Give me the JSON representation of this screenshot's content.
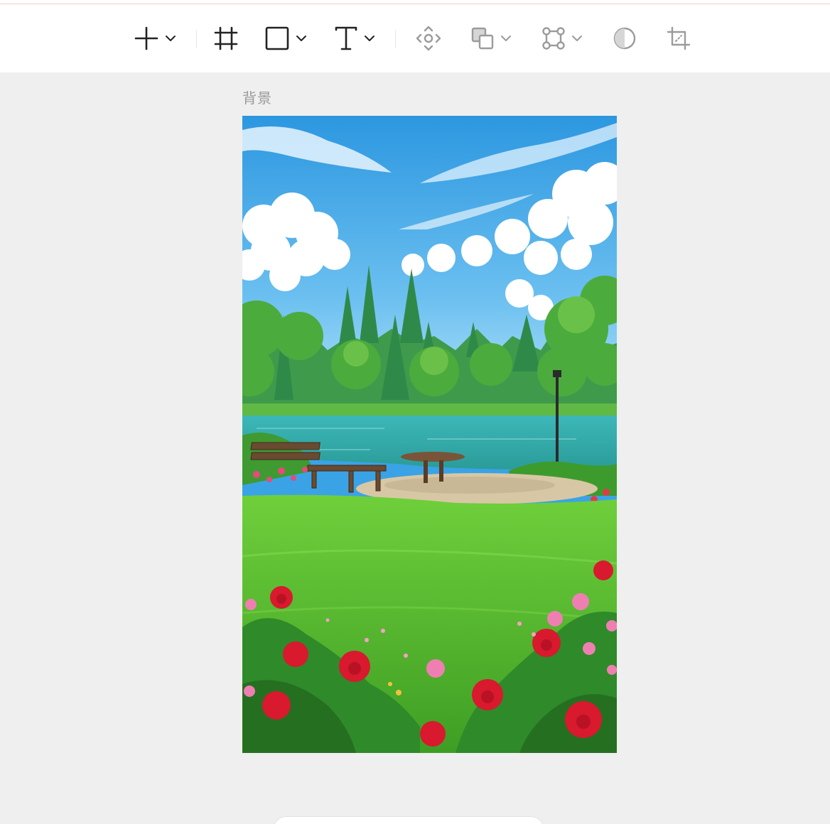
{
  "toolbar": {
    "tools": [
      {
        "icon": "plus-icon",
        "has_dropdown": true
      },
      {
        "icon": "frame-icon",
        "has_dropdown": false
      },
      {
        "icon": "rectangle-icon",
        "has_dropdown": true
      },
      {
        "icon": "text-icon",
        "has_dropdown": true
      },
      {
        "icon": "move-icon",
        "has_dropdown": false
      },
      {
        "icon": "boolean-shapes-icon",
        "has_dropdown": true
      },
      {
        "icon": "vector-path-icon",
        "has_dropdown": true
      },
      {
        "icon": "contrast-icon",
        "has_dropdown": false
      },
      {
        "icon": "crop-icon",
        "has_dropdown": false
      }
    ],
    "colors": {
      "icon": "#222222",
      "icon_muted": "#9b9b9b"
    }
  },
  "canvas": {
    "frame_label": "背景",
    "frame_image": {
      "icon": "park-landscape-image"
    },
    "background_color": "#efefef"
  }
}
